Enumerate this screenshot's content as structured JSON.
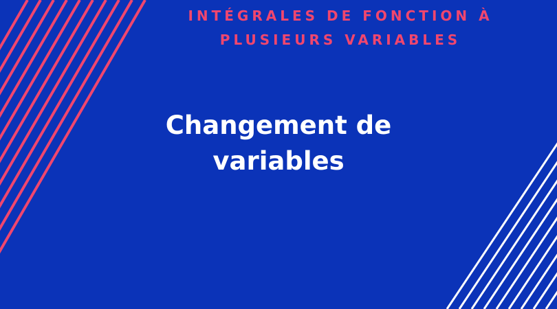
{
  "subtitle": {
    "line1": "INTÉGRALES DE FONCTION À",
    "line2": "PLUSIEURS VARIABLES"
  },
  "title": {
    "line1": "Changement de",
    "line2": "variables"
  },
  "colors": {
    "background": "#0b33b8",
    "accent": "#f0466e",
    "text": "#ffffff",
    "stripes_right": "#ffffff"
  }
}
